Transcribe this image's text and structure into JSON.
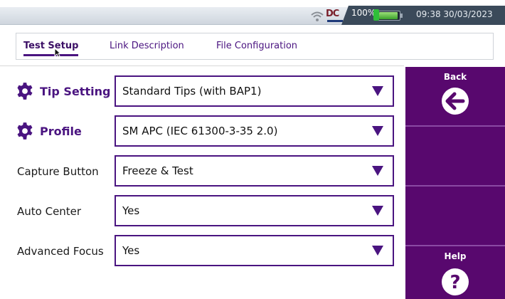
{
  "status_bar": {
    "battery_percent": "100%",
    "time": "09:38",
    "date": "30/03/2023",
    "logo": "DC",
    "icons": [
      "wifi-icon",
      "dc-logo",
      "battery-icon"
    ]
  },
  "tabs": [
    {
      "label": "Test Setup",
      "active": true
    },
    {
      "label": "Link Description",
      "active": false
    },
    {
      "label": "File Configuration",
      "active": false
    }
  ],
  "form": {
    "rows": [
      {
        "label": "Tip Setting",
        "value": "Standard Tips (with BAP1)",
        "gear": true
      },
      {
        "label": "Profile",
        "value": "SM APC (IEC 61300-3-35 2.0)",
        "gear": true
      },
      {
        "label": "Capture Button",
        "value": "Freeze & Test",
        "gear": false
      },
      {
        "label": "Auto Center",
        "value": "Yes",
        "gear": false
      },
      {
        "label": "Advanced Focus",
        "value": "Yes",
        "gear": false
      }
    ]
  },
  "sidebar": {
    "back_label": "Back",
    "help_label": "Help",
    "back_icon": "back-arrow-icon",
    "help_icon": "help-icon"
  },
  "colors": {
    "accent": "#4a1480",
    "sidebar": "#58086e",
    "status_panel": "#3b4a5a"
  }
}
